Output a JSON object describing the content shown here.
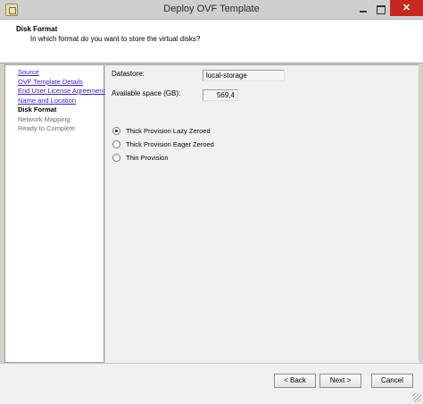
{
  "window": {
    "title": "Deploy OVF Template",
    "close_glyph": "✕"
  },
  "header": {
    "title": "Disk Format",
    "subtitle": "In which format do you want to store the virtual disks?"
  },
  "nav": {
    "items": [
      {
        "label": "Source",
        "state": "done"
      },
      {
        "label": "OVF Template Details",
        "state": "done"
      },
      {
        "label": "End User License Agreement",
        "state": "done"
      },
      {
        "label": "Name and Location",
        "state": "done"
      },
      {
        "label": "Disk Format",
        "state": "current"
      },
      {
        "label": "Network Mapping",
        "state": "pending"
      },
      {
        "label": "Ready to Complete",
        "state": "pending"
      }
    ]
  },
  "form": {
    "datastore_label": "Datastore:",
    "datastore_value": "local-storage",
    "space_label": "Available space (GB):",
    "space_value": "569,4",
    "provision_options": [
      {
        "label": "Thick Provision Lazy Zeroed",
        "selected": true
      },
      {
        "label": "Thick Provision Eager Zeroed",
        "selected": false
      },
      {
        "label": "Thin Provision",
        "selected": false
      }
    ]
  },
  "footer": {
    "back_label": "< Back",
    "next_label": "Next >",
    "cancel_label": "Cancel"
  },
  "colors": {
    "link": "#3b1cc7",
    "close_button": "#c7281e"
  }
}
